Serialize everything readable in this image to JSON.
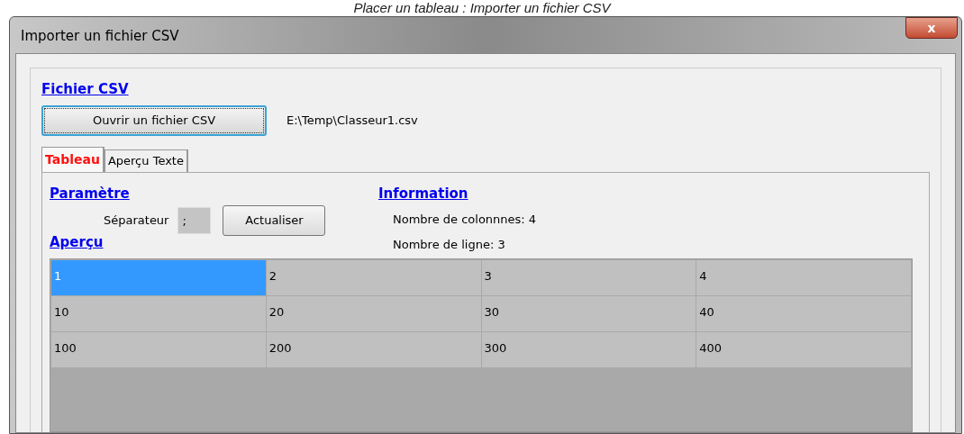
{
  "caption": "Placer un tableau : Importer un fichier CSV",
  "window": {
    "title": "Importer un fichier CSV",
    "close": "x"
  },
  "file_section": {
    "heading": "Fichier CSV",
    "open_button": "Ouvrir un fichier CSV",
    "path": "E:\\Temp\\Classeur1.csv"
  },
  "tabs": [
    {
      "label": "Tableau",
      "selected": true
    },
    {
      "label": "Aperçu Texte",
      "selected": false
    }
  ],
  "parameter": {
    "heading": "Paramètre",
    "separator_label": "Séparateur",
    "separator_value": ";",
    "refresh_button": "Actualiser"
  },
  "information": {
    "heading": "Information",
    "columns": "Nombre de colonnnes: 4",
    "rows": "Nombre de ligne: 3"
  },
  "preview": {
    "heading": "Aperçu",
    "rows": [
      {
        "cells": [
          {
            "text": "1",
            "selected": true
          },
          {
            "text": "2",
            "selected": false
          },
          {
            "text": "3",
            "selected": false
          },
          {
            "text": "4",
            "selected": false
          }
        ]
      },
      {
        "cells": [
          {
            "text": "10",
            "selected": false
          },
          {
            "text": "20",
            "selected": false
          },
          {
            "text": "30",
            "selected": false
          },
          {
            "text": "40",
            "selected": false
          }
        ]
      },
      {
        "cells": [
          {
            "text": "100",
            "selected": false
          },
          {
            "text": "200",
            "selected": false
          },
          {
            "text": "300",
            "selected": false
          },
          {
            "text": "400",
            "selected": false
          }
        ]
      }
    ]
  }
}
